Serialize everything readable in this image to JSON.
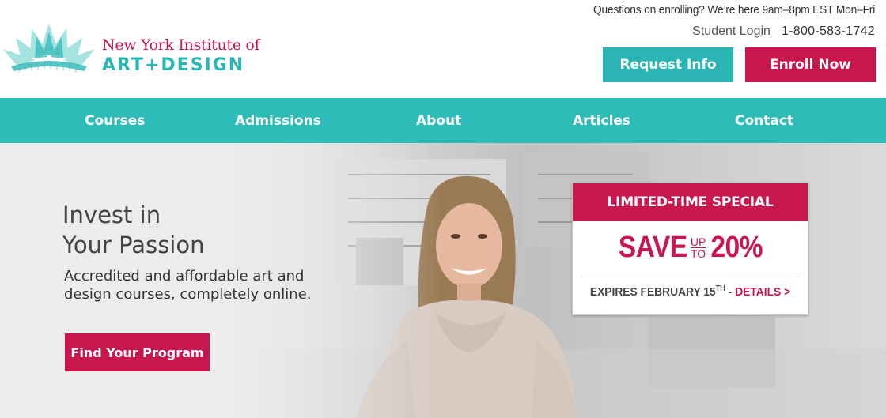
{
  "brand": {
    "line1": "New York Institute of",
    "line2": "ART+DESIGN",
    "colors": {
      "pink": "#c8174f",
      "teal": "#2bb5b4",
      "nav_teal": "#2ebcb9"
    }
  },
  "header": {
    "notice": "Questions on enrolling? We’re here 9am–8pm EST Mon–Fri",
    "student_login": "Student Login",
    "phone": "1-800-583-1742",
    "request_info": "Request Info",
    "enroll_now": "Enroll Now"
  },
  "nav": {
    "items": [
      {
        "label": "Courses"
      },
      {
        "label": "Admissions"
      },
      {
        "label": "About"
      },
      {
        "label": "Articles"
      },
      {
        "label": "Contact"
      }
    ]
  },
  "hero": {
    "title_line1": "Invest in",
    "title_line2": "Your Passion",
    "subtitle_line1": "Accredited and affordable art and",
    "subtitle_line2": "design courses, completely online.",
    "cta": "Find Your Program"
  },
  "promo": {
    "heading": "LIMITED-TIME SPECIAL",
    "save": "SAVE",
    "up": "UP",
    "to": "TO",
    "percent": "20%",
    "expires_prefix": "EXPIRES FEBRUARY 15",
    "expires_suffix": "TH",
    "separator": " - ",
    "details": "DETAILS >"
  }
}
